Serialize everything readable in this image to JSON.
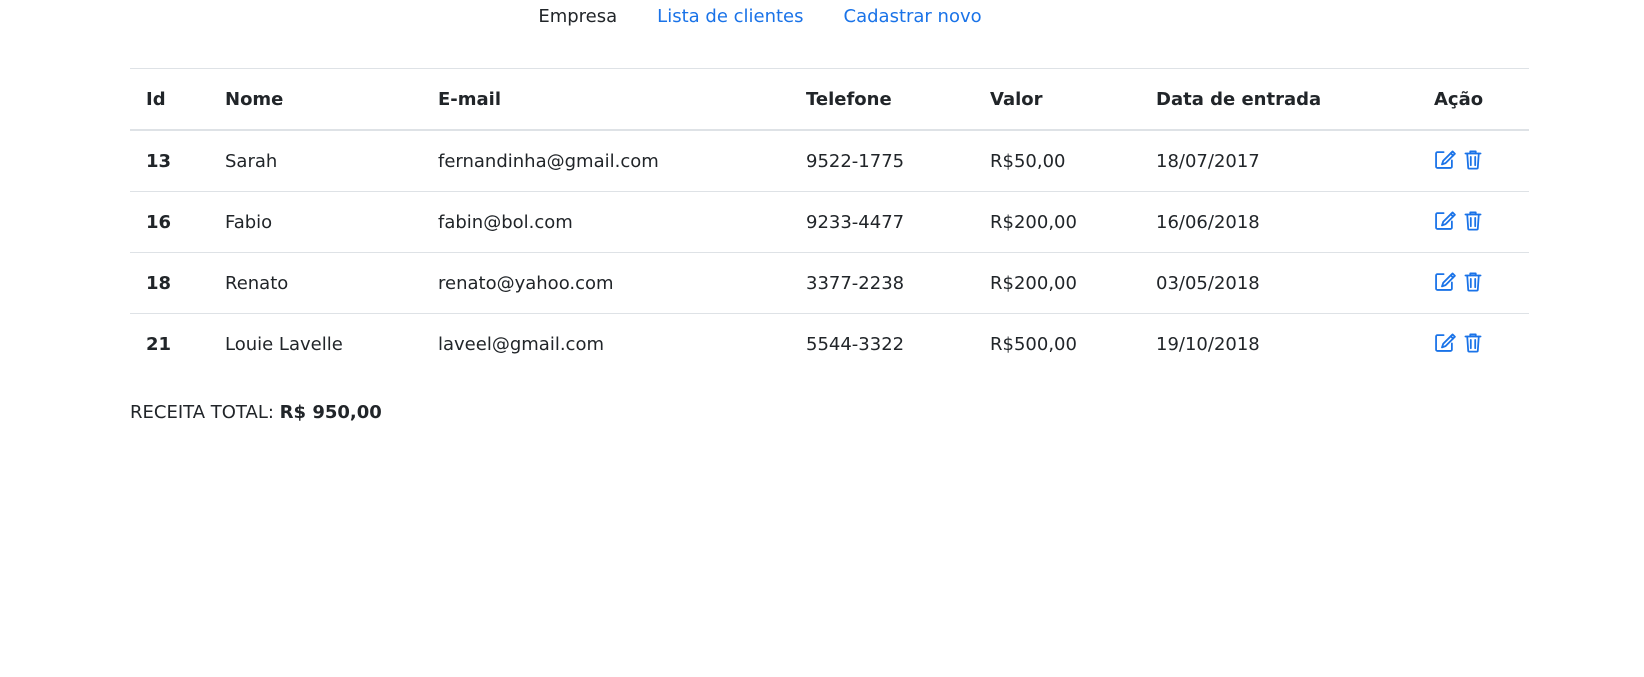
{
  "nav": {
    "brand": "Empresa",
    "links": [
      {
        "label": "Lista de clientes"
      },
      {
        "label": "Cadastrar novo"
      }
    ]
  },
  "table": {
    "headers": [
      "Id",
      "Nome",
      "E-mail",
      "Telefone",
      "Valor",
      "Data de entrada",
      "Ação"
    ],
    "rows": [
      {
        "id": "13",
        "nome": "Sarah",
        "email": "fernandinha@gmail.com",
        "telefone": "9522-1775",
        "valor": "R$50,00",
        "data": "18/07/2017"
      },
      {
        "id": "16",
        "nome": "Fabio",
        "email": "fabin@bol.com",
        "telefone": "9233-4477",
        "valor": "R$200,00",
        "data": "16/06/2018"
      },
      {
        "id": "18",
        "nome": "Renato",
        "email": "renato@yahoo.com",
        "telefone": "3377-2238",
        "valor": "R$200,00",
        "data": "03/05/2018"
      },
      {
        "id": "21",
        "nome": "Louie Lavelle",
        "email": "laveel@gmail.com",
        "telefone": "5544-3322",
        "valor": "R$500,00",
        "data": "19/10/2018"
      }
    ],
    "action_icons": [
      "edit-icon",
      "trash-icon"
    ]
  },
  "total": {
    "label": "RECEITA TOTAL:",
    "amount": "R$ 950,00"
  },
  "colors": {
    "link": "#1a73e8",
    "text": "#212529",
    "border": "#dee2e6"
  }
}
